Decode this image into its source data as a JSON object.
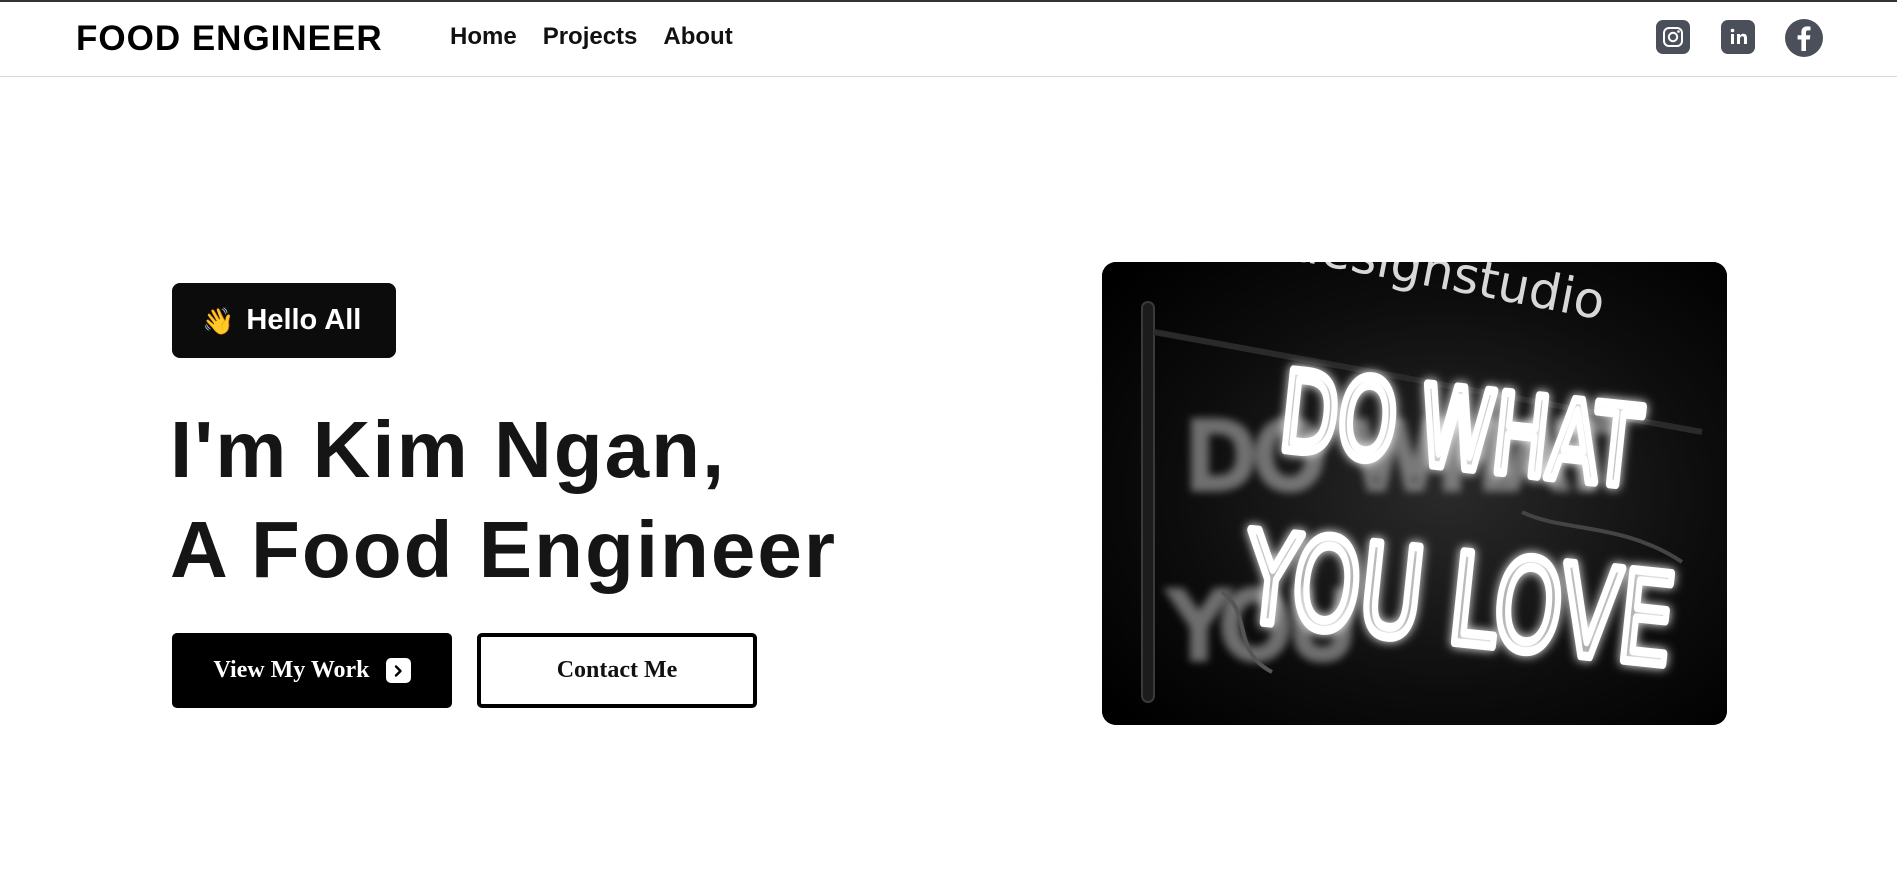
{
  "brand": "FOOD ENGINEER",
  "nav": {
    "items": [
      "Home",
      "Projects",
      "About"
    ]
  },
  "socials": [
    "instagram-icon",
    "linkedin-icon",
    "facebook-icon"
  ],
  "hero": {
    "greeting": "Hello All",
    "greeting_emoji": "👋",
    "headline_line1": "I'm Kim Ngan,",
    "headline_line2": "A Food Engineer",
    "primary_button": "View My Work",
    "secondary_button": "Contact Me"
  },
  "image": {
    "sign_top": "designstudio",
    "neon_line1": "DO WHAT",
    "neon_line2": "YOU LOVE"
  },
  "colors": {
    "primary": "#000000",
    "background": "#ffffff",
    "social_icon": "#4a4f5a"
  }
}
